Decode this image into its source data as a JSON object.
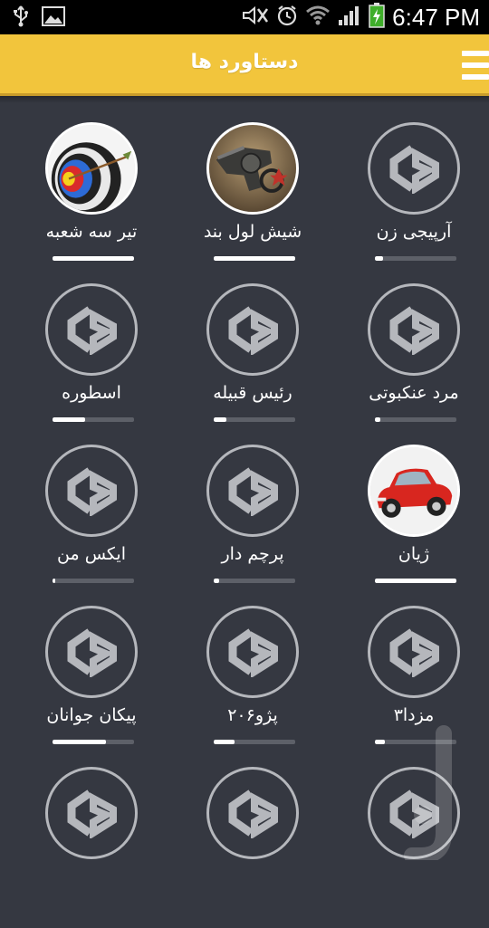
{
  "status_bar": {
    "time": "6:47 PM",
    "left_icons": [
      "usb-icon",
      "image-icon"
    ],
    "right_icons": [
      "mute-icon",
      "alarm-icon",
      "wifi-icon",
      "signal-icon",
      "battery-charging-icon"
    ]
  },
  "app_bar": {
    "title": "دستاورد ها",
    "menu_icon": "hamburger-menu-icon",
    "color": "#f2c53c"
  },
  "achievements": [
    {
      "label": "تیر سه شعبه",
      "icon": "archery-target-icon",
      "progress": 1.0
    },
    {
      "label": "شیش لول بند",
      "icon": "revolver-icon",
      "progress": 1.0
    },
    {
      "label": "آرپیجی زن",
      "icon": "locked-logo-icon",
      "progress": 0.1
    },
    {
      "label": "اسطوره",
      "icon": "locked-logo-icon",
      "progress": 0.4
    },
    {
      "label": "رئیس قبیله",
      "icon": "locked-logo-icon",
      "progress": 0.15
    },
    {
      "label": "مرد عنکبوتی",
      "icon": "locked-logo-icon",
      "progress": 0.07
    },
    {
      "label": "ایکس من",
      "icon": "locked-logo-icon",
      "progress": 0.03
    },
    {
      "label": "پرچم دار",
      "icon": "locked-logo-icon",
      "progress": 0.07
    },
    {
      "label": "ژیان",
      "icon": "red-car-icon",
      "progress": 1.0
    },
    {
      "label": "پیکان جوانان",
      "icon": "locked-logo-icon",
      "progress": 0.65
    },
    {
      "label": "پژو۲۰۶",
      "icon": "locked-logo-icon",
      "progress": 0.25
    },
    {
      "label": "مزدا۳",
      "icon": "locked-logo-icon",
      "progress": 0.12
    },
    {
      "label": "",
      "icon": "locked-logo-icon",
      "progress": 0
    },
    {
      "label": "",
      "icon": "locked-logo-icon",
      "progress": 0
    },
    {
      "label": "",
      "icon": "locked-logo-icon",
      "progress": 0
    }
  ]
}
